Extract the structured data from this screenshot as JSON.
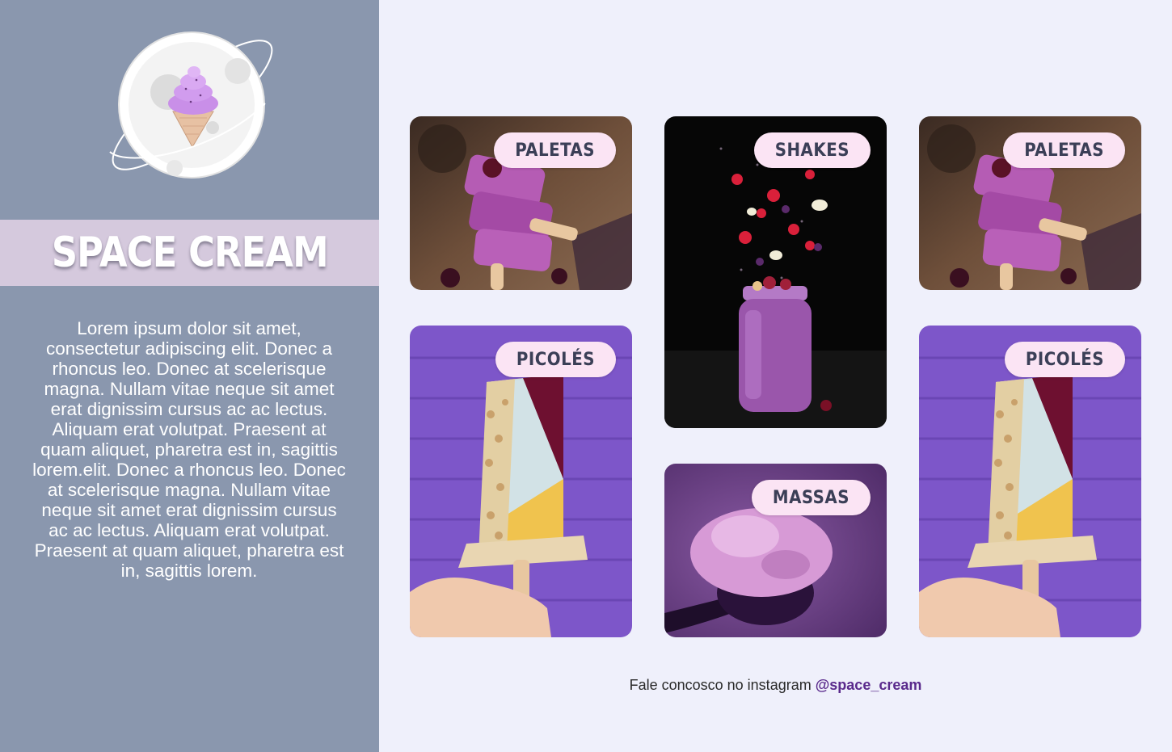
{
  "brand": {
    "title": "SPACE CREAM",
    "description": "Lorem ipsum dolor sit amet, consectetur adipiscing elit. Donec a rhoncus leo. Donec at scelerisque magna. Nullam vitae neque sit amet erat dignissim cursus ac ac lectus. Aliquam erat volutpat. Praesent at quam aliquet, pharetra est in, sagittis lorem.elit. Donec a rhoncus leo. Donec at scelerisque magna. Nullam vitae neque sit amet erat dignissim cursus ac ac lectus. Aliquam erat volutpat. Praesent at quam aliquet, pharetra est in, sagittis lorem.",
    "logo_icon": "planet-ice-cream-logo"
  },
  "cards": [
    {
      "label": "PALETAS",
      "image": "stacked-purple-ice-cream-bars"
    },
    {
      "label": "SHAKES",
      "image": "purple-milkshake-jar-with-falling-fruit"
    },
    {
      "label": "PALETAS",
      "image": "stacked-purple-ice-cream-bars"
    },
    {
      "label": "PICOLÉS",
      "image": "layered-popsicle-with-nuts-on-purple-brick"
    },
    {
      "label": "MASSAS",
      "image": "scoop-of-purple-ice-cream-on-spoon"
    },
    {
      "label": "PICOLÉS",
      "image": "layered-popsicle-with-nuts-on-purple-brick"
    }
  ],
  "footer": {
    "text": "Fale concosco no instagram",
    "handle": "@space_cream"
  },
  "colors": {
    "sidebar": "#8a97ae",
    "title_band": "#d5c9dd",
    "page_background": "#eff0fb",
    "badge": "#fbe4f4",
    "link": "#5a2a8c"
  }
}
